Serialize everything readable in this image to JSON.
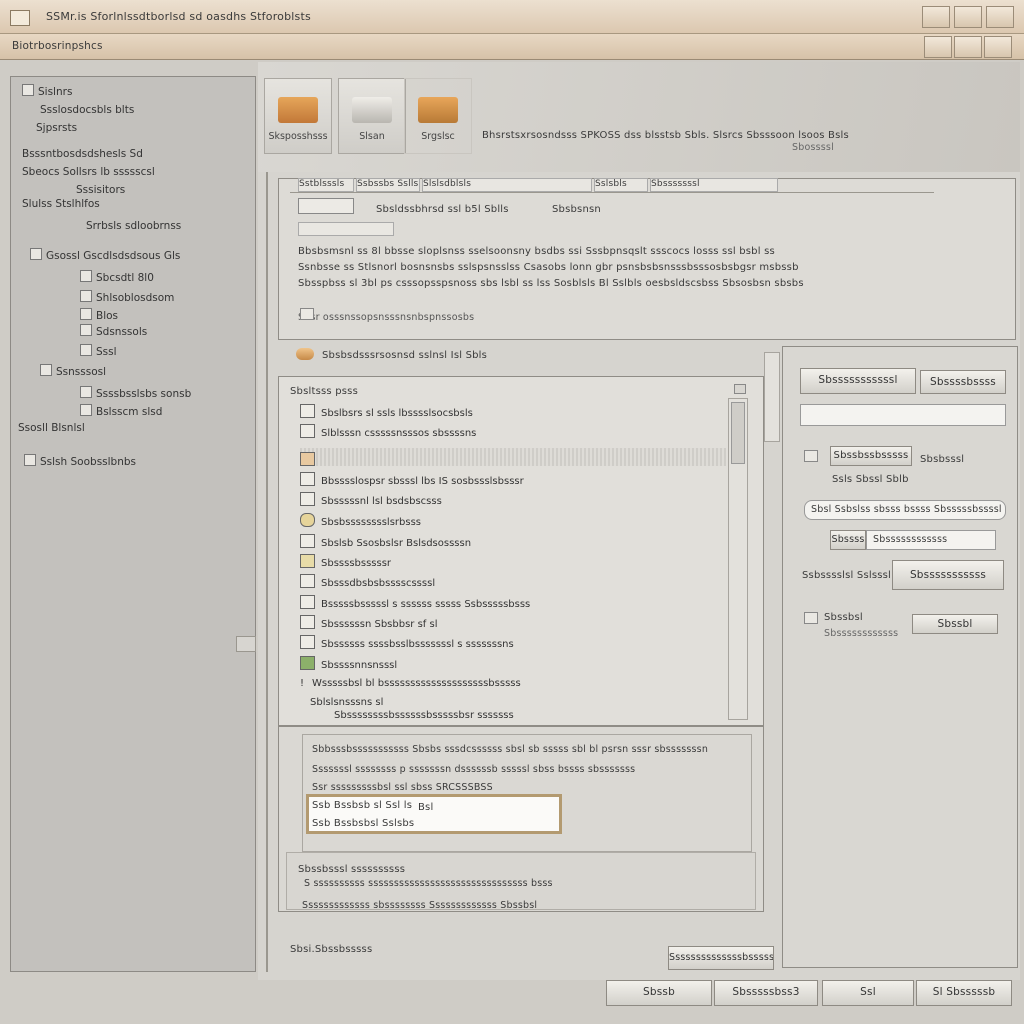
{
  "window": {
    "title": "SSMr.is Sforlnlssdtborlsd sd oasdhs Stforoblsts",
    "menu_label": "Biotrbosrinpshcs"
  },
  "tree": {
    "items": [
      "Sislnrs",
      "Ssslosdocsbls blts",
      "Sjpsrsts",
      "Bsssntbosdsdshesls Sd",
      "Sbeocs Sollsrs lb ssssscsl",
      "Sssisitors",
      "Slulss   Stslhlfos",
      "Srrbsls sdloobrnss",
      "Gsossl Gscdlsdsdsous Gls",
      "Sbcsdtl 8l0",
      "Shlsoblosdsom",
      "Blos",
      "Sdsnssols",
      "Sssl",
      "Ssnsssosl",
      "Ssssbsslsbs sonsb",
      "Bslsscm slsd",
      "Ssosll Blsnlsl",
      "Sslsh Soobsslbnbs"
    ]
  },
  "toolbar": {
    "buttons": [
      "Sksposshsss",
      "Slsan",
      "Srgslsc"
    ],
    "info_line": "Bhsrstsxrsosndsss SPKOSS dss blsstsb Sbls. Slsrcs Sbsssoon lsoos Bsls",
    "info_sub": "Sbossssl"
  },
  "header_panel": {
    "tabs": [
      "Sstblsssls",
      "Ssbssbs Sslls",
      "Slslsdblsls",
      "Sslsbls",
      "Sbsssssssl"
    ],
    "title_left": "Sbsldssbhrsd ssl b5l Sblls",
    "title_right": "Sbsbsnsn",
    "desc1": "Bbsbsmsnl ss 8l bbsse sloplsnss sselsoonsny bsdbs ssi Sssbpnsqslt ssscocs losss ssl bsbl ss",
    "desc2": "Ssnbsse ss Stlsnorl bosnsnsbs sslspsnsslss Csasobs lonn gbr psnsbsbsnsssbsssosbsbgsr msbssb",
    "desc3": "Sbsspbss sl 3bl ps csssopsspsnoss sbs lsbl ss lss Sosblsls Bl Sslbls oesbsldscsbss Sbsosbsn sbsbs",
    "footer": "Sbsr osssnssopsnsssnsnbspnssosbs"
  },
  "section": {
    "label": "Sbsbsdsssrsosnsd sslnsl Isl Sbls"
  },
  "list": {
    "header": "Sbsltsss psss",
    "rows": [
      "Sbslbsrs  sl ssls lbsssslsocsbsls",
      "Slblsssn  csssssnsssos sbssssns",
      "",
      "Bbsssslospsr sbsssl lbs IS sosbssslsbsssr",
      "Sbsssssnl lsl bsdsbscsss",
      "Sbsbsssssssslsrbsss",
      "Sbslsb Ssosbslsr Bslsdsossssn",
      "Sbssssbsssssr",
      "Sbsssdbsbsbsssscssssl",
      "Bsssssbsssssl s ssssss sssss Ssbsssssbsss",
      "Sbssssssn Sbsbbsr sf sl",
      "Sbssssss ssssbsslbsssssssl s sssssssns",
      "Sbssssnnsnsssl",
      "Wsssssbsl bl bssssssssssssssssssssbsssss",
      "Sblslsnsssns sl",
      "Sbssssssssbssssssbsssssbsr sssssss"
    ]
  },
  "detail": {
    "line1": "Sbbsssbsssssssssss Sbsbs sssdcssssss sbsl sb sssss sbl bl psrsn sssr sbsssssssn",
    "line2": "Sssssssl ssssssss p sssssssn dssssssb sssssl sbss bssss sbsssssss",
    "line3": "Ssr sssssssssbsl ssl sbss SRCSSSBSS",
    "input1": "Ssb Bssbsb sl Ssl ls",
    "input1_suffix": "Bsl",
    "input2": "Ssb Bssbsbsl Sslsbs"
  },
  "summary": {
    "label": "Sbssbsssl ssssssssss",
    "line": "S ssssssssss sssssssssssssssssssssssssssssss bsss",
    "footer": "Sssssssssssss sbssssssss Sssssssssssss Sbssbsl"
  },
  "status": {
    "left": "Sbsi.Sbssbsssss",
    "right": "Ssssssssssssssbsssss"
  },
  "right_panel": {
    "button1": "Sbsssssssssssl",
    "button2": "Sbssssbssss",
    "field1": "",
    "row1_btn": "Sbssbssbsssss",
    "row1_label": "Sbsbsssl",
    "row1_sub": "Ssls  Sbssl Sblb",
    "opt1": "Sbsl Ssbslss sbsss bssss Sbsssssbssssl",
    "opt1_btn": "Sbssss",
    "opt1_field": "Sbssssssssssss",
    "row2_label": "Ssbsssslsl Sslsssl",
    "row2_btn": "Sbsssssssssss",
    "row3_label": "Sbssbsl",
    "row3_sub": "Sbssssssssssss",
    "row3_btn": "Sbssbl"
  },
  "footer_buttons": [
    "Sbssb",
    "Sbsssssbss3",
    "Ssl",
    "Sl Sbsssssb"
  ],
  "colors": {
    "title_bg": "#dcc8b0",
    "accent_border": "#b39a70",
    "tree_bg": "#c3c1bd"
  }
}
